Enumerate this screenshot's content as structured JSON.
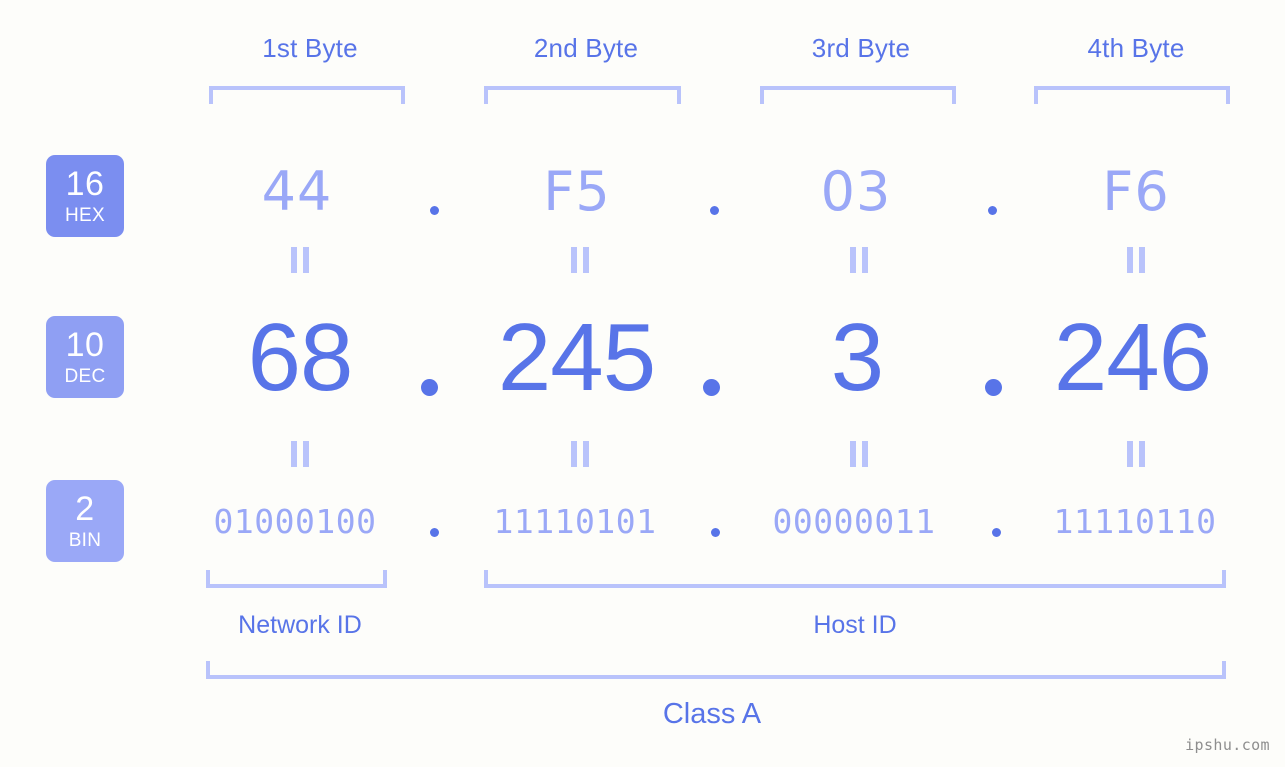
{
  "meta": {
    "background_color": "#fdfdfa",
    "accent_strong": "#5874e8",
    "accent_light": "#9aa8f7",
    "accent_pale": "#b9c3fb",
    "watermark": "ipshu.com"
  },
  "headers": [
    {
      "label": "1st Byte"
    },
    {
      "label": "2nd Byte"
    },
    {
      "label": "3rd Byte"
    },
    {
      "label": "4th Byte"
    }
  ],
  "bases": [
    {
      "number": "16",
      "name": "HEX",
      "color": "#7b8ef0"
    },
    {
      "number": "10",
      "name": "DEC",
      "color": "#8f9ff3"
    },
    {
      "number": "2",
      "name": "BIN",
      "color": "#9aa8f7"
    }
  ],
  "rows": {
    "hex": {
      "values": [
        "44",
        "F5",
        "03",
        "F6"
      ],
      "separator": "."
    },
    "dec": {
      "values": [
        "68",
        "245",
        "3",
        "246"
      ],
      "separator": "."
    },
    "bin": {
      "values": [
        "01000100",
        "11110101",
        "00000011",
        "11110110"
      ],
      "separator": "."
    }
  },
  "equivalence_marks": [
    "=",
    "=",
    "=",
    "=",
    "=",
    "=",
    "=",
    "="
  ],
  "sections": [
    {
      "label": "Network ID"
    },
    {
      "label": "Host ID"
    }
  ],
  "class": {
    "label": "Class A"
  }
}
